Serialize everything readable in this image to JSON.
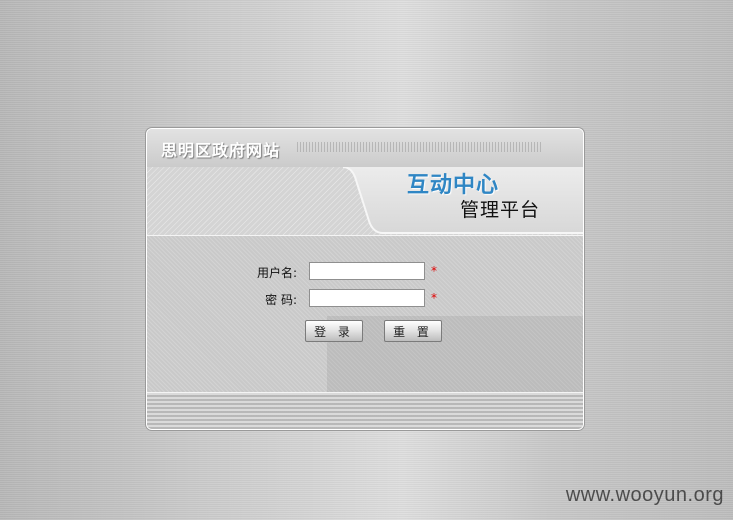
{
  "site": {
    "title": "思明区政府网站"
  },
  "banner": {
    "main_title": "互动中心",
    "sub_title": "管理平台"
  },
  "login": {
    "username_label": "用户名:",
    "password_label": "密  码:",
    "required_mark": "*",
    "username_value": "",
    "password_value": "",
    "login_button": "登 录",
    "reset_button": "重 置"
  },
  "colors": {
    "banner_blue": "#2f86c4",
    "required_red": "#e00000"
  },
  "watermark": {
    "text": "www.wooyun.org"
  }
}
